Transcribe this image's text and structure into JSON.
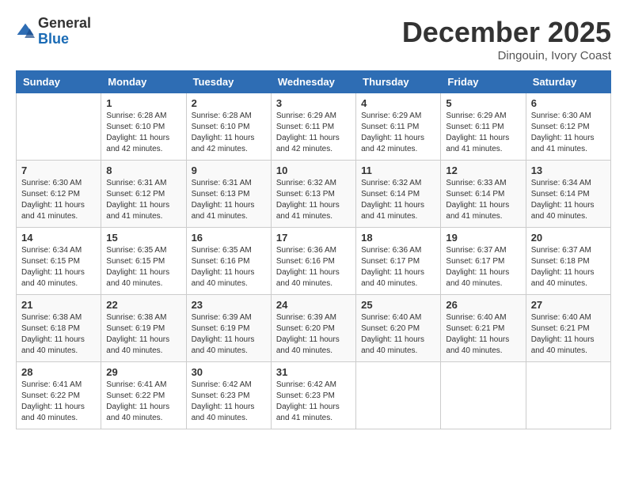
{
  "header": {
    "logo_general": "General",
    "logo_blue": "Blue",
    "month_title": "December 2025",
    "location": "Dingouin, Ivory Coast"
  },
  "weekdays": [
    "Sunday",
    "Monday",
    "Tuesday",
    "Wednesday",
    "Thursday",
    "Friday",
    "Saturday"
  ],
  "weeks": [
    [
      {
        "day": "",
        "info": ""
      },
      {
        "day": "1",
        "info": "Sunrise: 6:28 AM\nSunset: 6:10 PM\nDaylight: 11 hours\nand 42 minutes."
      },
      {
        "day": "2",
        "info": "Sunrise: 6:28 AM\nSunset: 6:10 PM\nDaylight: 11 hours\nand 42 minutes."
      },
      {
        "day": "3",
        "info": "Sunrise: 6:29 AM\nSunset: 6:11 PM\nDaylight: 11 hours\nand 42 minutes."
      },
      {
        "day": "4",
        "info": "Sunrise: 6:29 AM\nSunset: 6:11 PM\nDaylight: 11 hours\nand 42 minutes."
      },
      {
        "day": "5",
        "info": "Sunrise: 6:29 AM\nSunset: 6:11 PM\nDaylight: 11 hours\nand 41 minutes."
      },
      {
        "day": "6",
        "info": "Sunrise: 6:30 AM\nSunset: 6:12 PM\nDaylight: 11 hours\nand 41 minutes."
      }
    ],
    [
      {
        "day": "7",
        "info": "Sunrise: 6:30 AM\nSunset: 6:12 PM\nDaylight: 11 hours\nand 41 minutes."
      },
      {
        "day": "8",
        "info": "Sunrise: 6:31 AM\nSunset: 6:12 PM\nDaylight: 11 hours\nand 41 minutes."
      },
      {
        "day": "9",
        "info": "Sunrise: 6:31 AM\nSunset: 6:13 PM\nDaylight: 11 hours\nand 41 minutes."
      },
      {
        "day": "10",
        "info": "Sunrise: 6:32 AM\nSunset: 6:13 PM\nDaylight: 11 hours\nand 41 minutes."
      },
      {
        "day": "11",
        "info": "Sunrise: 6:32 AM\nSunset: 6:14 PM\nDaylight: 11 hours\nand 41 minutes."
      },
      {
        "day": "12",
        "info": "Sunrise: 6:33 AM\nSunset: 6:14 PM\nDaylight: 11 hours\nand 41 minutes."
      },
      {
        "day": "13",
        "info": "Sunrise: 6:34 AM\nSunset: 6:14 PM\nDaylight: 11 hours\nand 40 minutes."
      }
    ],
    [
      {
        "day": "14",
        "info": "Sunrise: 6:34 AM\nSunset: 6:15 PM\nDaylight: 11 hours\nand 40 minutes."
      },
      {
        "day": "15",
        "info": "Sunrise: 6:35 AM\nSunset: 6:15 PM\nDaylight: 11 hours\nand 40 minutes."
      },
      {
        "day": "16",
        "info": "Sunrise: 6:35 AM\nSunset: 6:16 PM\nDaylight: 11 hours\nand 40 minutes."
      },
      {
        "day": "17",
        "info": "Sunrise: 6:36 AM\nSunset: 6:16 PM\nDaylight: 11 hours\nand 40 minutes."
      },
      {
        "day": "18",
        "info": "Sunrise: 6:36 AM\nSunset: 6:17 PM\nDaylight: 11 hours\nand 40 minutes."
      },
      {
        "day": "19",
        "info": "Sunrise: 6:37 AM\nSunset: 6:17 PM\nDaylight: 11 hours\nand 40 minutes."
      },
      {
        "day": "20",
        "info": "Sunrise: 6:37 AM\nSunset: 6:18 PM\nDaylight: 11 hours\nand 40 minutes."
      }
    ],
    [
      {
        "day": "21",
        "info": "Sunrise: 6:38 AM\nSunset: 6:18 PM\nDaylight: 11 hours\nand 40 minutes."
      },
      {
        "day": "22",
        "info": "Sunrise: 6:38 AM\nSunset: 6:19 PM\nDaylight: 11 hours\nand 40 minutes."
      },
      {
        "day": "23",
        "info": "Sunrise: 6:39 AM\nSunset: 6:19 PM\nDaylight: 11 hours\nand 40 minutes."
      },
      {
        "day": "24",
        "info": "Sunrise: 6:39 AM\nSunset: 6:20 PM\nDaylight: 11 hours\nand 40 minutes."
      },
      {
        "day": "25",
        "info": "Sunrise: 6:40 AM\nSunset: 6:20 PM\nDaylight: 11 hours\nand 40 minutes."
      },
      {
        "day": "26",
        "info": "Sunrise: 6:40 AM\nSunset: 6:21 PM\nDaylight: 11 hours\nand 40 minutes."
      },
      {
        "day": "27",
        "info": "Sunrise: 6:40 AM\nSunset: 6:21 PM\nDaylight: 11 hours\nand 40 minutes."
      }
    ],
    [
      {
        "day": "28",
        "info": "Sunrise: 6:41 AM\nSunset: 6:22 PM\nDaylight: 11 hours\nand 40 minutes."
      },
      {
        "day": "29",
        "info": "Sunrise: 6:41 AM\nSunset: 6:22 PM\nDaylight: 11 hours\nand 40 minutes."
      },
      {
        "day": "30",
        "info": "Sunrise: 6:42 AM\nSunset: 6:23 PM\nDaylight: 11 hours\nand 40 minutes."
      },
      {
        "day": "31",
        "info": "Sunrise: 6:42 AM\nSunset: 6:23 PM\nDaylight: 11 hours\nand 41 minutes."
      },
      {
        "day": "",
        "info": ""
      },
      {
        "day": "",
        "info": ""
      },
      {
        "day": "",
        "info": ""
      }
    ]
  ]
}
